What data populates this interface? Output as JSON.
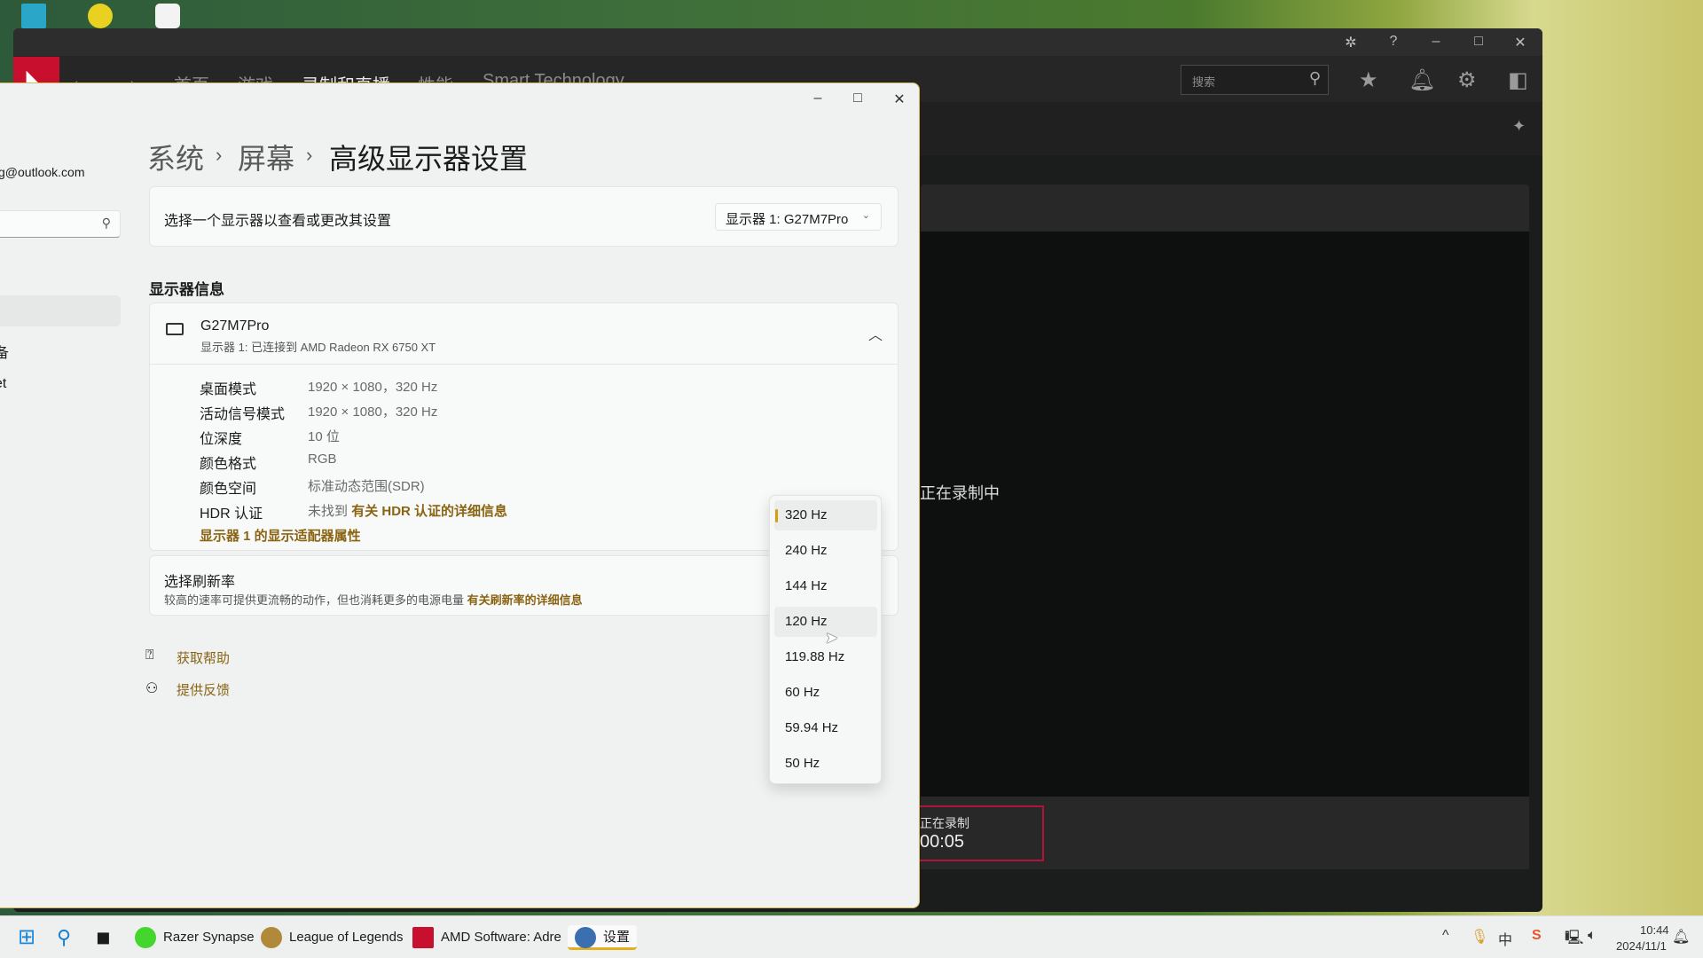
{
  "amd": {
    "nav": {
      "back": "←",
      "forward": "→",
      "tabs": [
        "首页",
        "游戏",
        "录制和直播",
        "性能",
        "Smart Technology"
      ],
      "active_tab": "录制和直播"
    },
    "search_placeholder": "搜索",
    "recording_status": "正在录制中",
    "recording_label": "正在录制",
    "recording_time": "00:05",
    "brand_color": "#c8102e"
  },
  "settings": {
    "breadcrumb": [
      "系统",
      "屏幕",
      "高级显示器设置"
    ],
    "sidebar": {
      "email": "g@outlook.com",
      "items": [
        "",
        "备",
        "et",
        ":"
      ]
    },
    "select_display": {
      "label": "选择一个显示器以查看或更改其设置",
      "value": "显示器 1: G27M7Pro"
    },
    "info_heading": "显示器信息",
    "monitor": {
      "name": "G27M7Pro",
      "subtitle": "显示器 1: 已连接到 AMD Radeon RX 6750 XT",
      "rows": [
        {
          "label": "桌面模式",
          "value": "1920 × 1080，320 Hz"
        },
        {
          "label": "活动信号模式",
          "value": "1920 × 1080，320 Hz"
        },
        {
          "label": "位深度",
          "value": "10 位"
        },
        {
          "label": "颜色格式",
          "value": "RGB"
        },
        {
          "label": "颜色空间",
          "value": "标准动态范围(SDR)"
        },
        {
          "label": "HDR 认证",
          "value": "未找到",
          "link": "有关 HDR 认证的详细信息"
        }
      ],
      "adapter_link": "显示器 1 的显示适配器属性"
    },
    "refresh": {
      "title": "选择刷新率",
      "desc": "较高的速率可提供更流畅的动作，但也消耗更多的电源电量",
      "link": "有关刷新率的详细信息",
      "options": [
        "320 Hz",
        "240 Hz",
        "144 Hz",
        "120 Hz",
        "119.88 Hz",
        "60 Hz",
        "59.94 Hz",
        "50 Hz"
      ],
      "selected": "320 Hz",
      "hovered": "120 Hz"
    },
    "help": {
      "get_help": "获取帮助",
      "feedback": "提供反馈"
    },
    "accent_color": "#8a6413"
  },
  "taskbar": {
    "apps": [
      "Razer Synapse",
      "League of Legends",
      "AMD Software: Adre",
      "设置"
    ],
    "active_app": "设置",
    "ime": "中",
    "time": "10:44",
    "date": "2024/11/1"
  }
}
